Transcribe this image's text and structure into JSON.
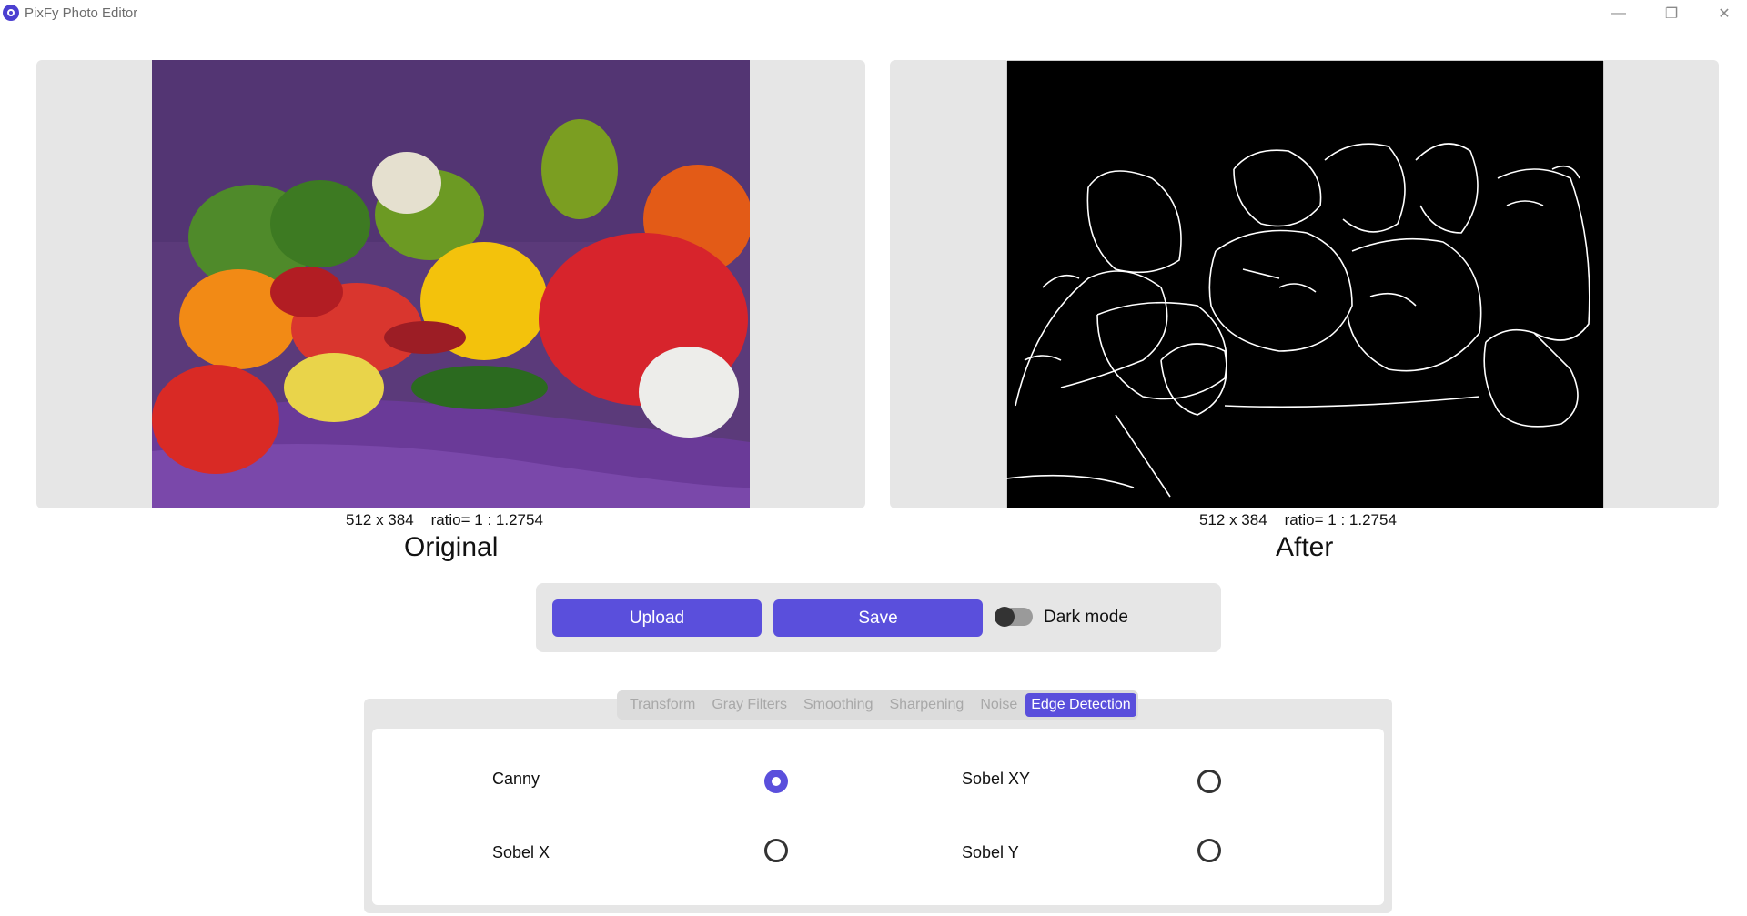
{
  "window": {
    "title": "PixFy Photo Editor",
    "controls": {
      "minimize": "—",
      "maximize": "❐",
      "close": "✕"
    }
  },
  "original": {
    "info": "512 x 384    ratio= 1 : 1.2754",
    "caption": "Original"
  },
  "after": {
    "info": "512 x 384    ratio= 1 : 1.2754",
    "caption": "After"
  },
  "actions": {
    "upload": "Upload",
    "save": "Save",
    "dark_mode": "Dark mode",
    "dark_mode_on": false
  },
  "tabs": [
    {
      "label": "Transform",
      "active": false
    },
    {
      "label": "Gray Filters",
      "active": false
    },
    {
      "label": "Smoothing",
      "active": false
    },
    {
      "label": "Sharpening",
      "active": false
    },
    {
      "label": "Noise",
      "active": false
    },
    {
      "label": "Edge Detection",
      "active": true
    }
  ],
  "options": [
    {
      "label": "Canny",
      "selected": true
    },
    {
      "label": "Sobel XY",
      "selected": false
    },
    {
      "label": "Sobel X",
      "selected": false
    },
    {
      "label": "Sobel Y",
      "selected": false
    }
  ],
  "colors": {
    "accent": "#5a4fdc",
    "panel": "#e6e6e6",
    "backdrop": "#5b3a7a"
  }
}
